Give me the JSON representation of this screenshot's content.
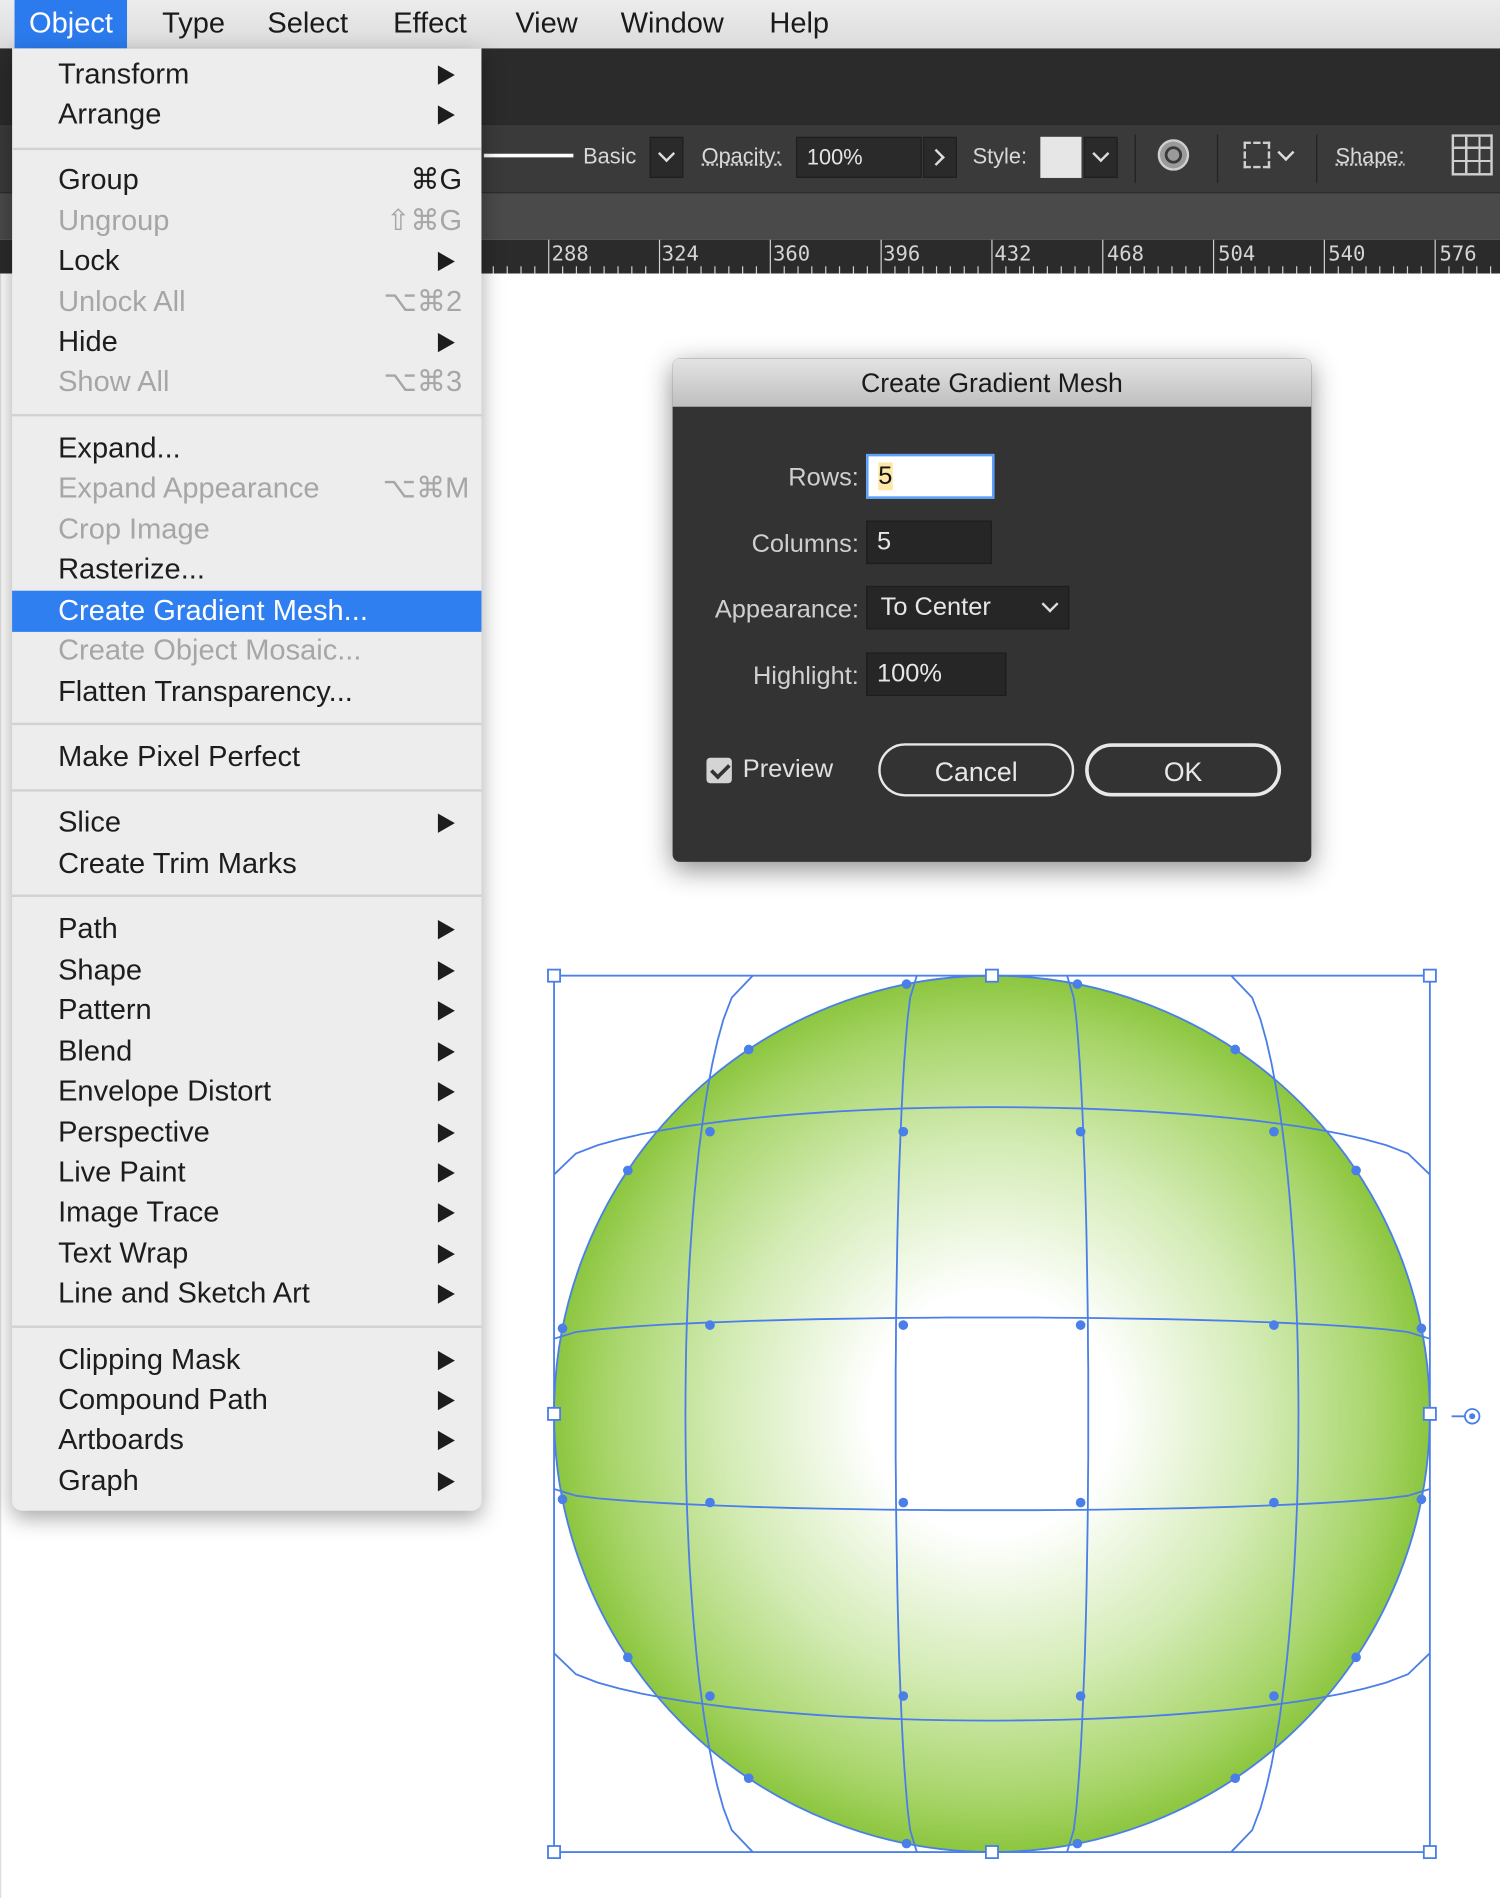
{
  "menubar": {
    "items": [
      "Object",
      "Type",
      "Select",
      "Effect",
      "View",
      "Window",
      "Help"
    ],
    "active": "Object"
  },
  "control_bar": {
    "stroke_profile": "Basic",
    "opacity_label": "Opacity:",
    "opacity_value": "100%",
    "style_label": "Style:",
    "shape_label": "Shape:"
  },
  "ruler": {
    "labels": [
      "288",
      "324",
      "360",
      "396",
      "432",
      "468",
      "504",
      "540",
      "576"
    ]
  },
  "object_menu": {
    "transform": "Transform",
    "arrange": "Arrange",
    "group": "Group",
    "group_shortcut": "⌘G",
    "ungroup": "Ungroup",
    "ungroup_shortcut": "⇧⌘G",
    "lock": "Lock",
    "unlock_all": "Unlock All",
    "unlock_all_shortcut": "⌥⌘2",
    "hide": "Hide",
    "show_all": "Show All",
    "show_all_shortcut": "⌥⌘3",
    "expand": "Expand...",
    "expand_appearance": "Expand Appearance",
    "expand_appearance_shortcut": "⌥⌘M",
    "crop_image": "Crop Image",
    "rasterize": "Rasterize...",
    "create_gradient_mesh": "Create Gradient Mesh...",
    "create_object_mosaic": "Create Object Mosaic...",
    "flatten_transparency": "Flatten Transparency...",
    "make_pixel_perfect": "Make Pixel Perfect",
    "slice": "Slice",
    "create_trim_marks": "Create Trim Marks",
    "path": "Path",
    "shape": "Shape",
    "pattern": "Pattern",
    "blend": "Blend",
    "envelope_distort": "Envelope Distort",
    "perspective": "Perspective",
    "live_paint": "Live Paint",
    "image_trace": "Image Trace",
    "text_wrap": "Text Wrap",
    "line_and_sketch_art": "Line and Sketch Art",
    "clipping_mask": "Clipping Mask",
    "compound_path": "Compound Path",
    "artboards": "Artboards",
    "graph": "Graph"
  },
  "dialog": {
    "title": "Create Gradient Mesh",
    "rows_label": "Rows:",
    "rows_value": "5",
    "columns_label": "Columns:",
    "columns_value": "5",
    "appearance_label": "Appearance:",
    "appearance_value": "To Center",
    "highlight_label": "Highlight:",
    "highlight_value": "100%",
    "preview_label": "Preview",
    "preview_checked": true,
    "cancel_label": "Cancel",
    "ok_label": "OK"
  },
  "colors": {
    "menu_highlight": "#2f7ff0",
    "mesh_edge_green": "#8cc63f",
    "selection_blue": "#4a7ee8"
  }
}
